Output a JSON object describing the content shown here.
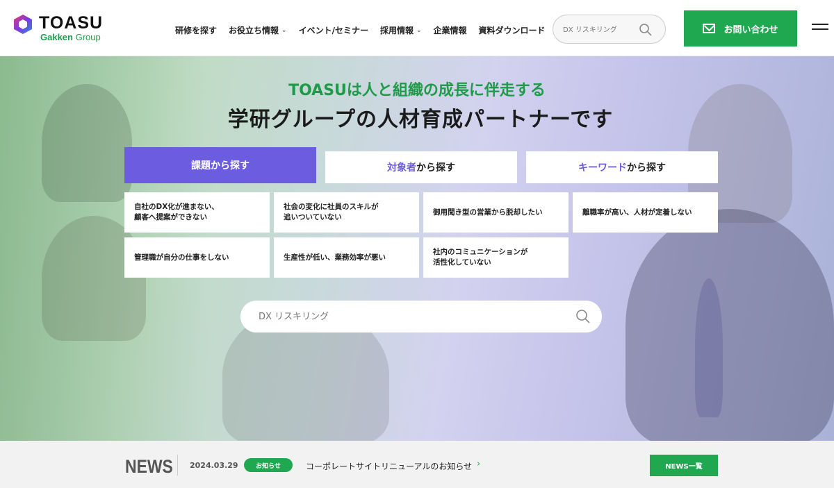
{
  "brand": {
    "name": "TOASU",
    "sub_bold": "Gakken",
    "sub_light": " Group"
  },
  "nav": [
    {
      "label": "研修を探す",
      "dropdown": false
    },
    {
      "label": "お役立ち情報",
      "dropdown": true
    },
    {
      "label": "イベント/セミナー",
      "dropdown": false
    },
    {
      "label": "採用情報",
      "dropdown": true
    },
    {
      "label": "企業情報",
      "dropdown": false
    },
    {
      "label": "資料ダウンロード",
      "dropdown": false
    }
  ],
  "header_search": {
    "placeholder": "DX リスキリング"
  },
  "contact_button": {
    "label": "お問い合わせ"
  },
  "hero": {
    "subtitle": "TOASUは人と組織の成長に伴走する",
    "title": "学研グループの人材育成パートナーです",
    "tabs": {
      "issue": {
        "label": "課題から探す"
      },
      "target": {
        "highlight": "対象者",
        "rest": "から探す"
      },
      "keyword": {
        "highlight": "キーワード",
        "rest": "から探す"
      }
    },
    "cards": [
      {
        "line1": "自社のDX化が進まない、",
        "line2": "顧客へ提案ができない"
      },
      {
        "line1": "社会の変化に社員のスキルが",
        "line2": "追いついていない"
      },
      {
        "line1": "御用聞き型の営業から脱却したい",
        "line2": ""
      },
      {
        "line1": "離職率が高い、人材が定着しない",
        "line2": ""
      },
      {
        "line1": "管理職が自分の仕事をしない",
        "line2": ""
      },
      {
        "line1": "生産性が低い、業務効率が悪い",
        "line2": ""
      },
      {
        "line1": "社内のコミュニケーションが",
        "line2": "活性化していない"
      }
    ],
    "search": {
      "placeholder": "DX リスキリング"
    }
  },
  "news": {
    "label": "NEWS",
    "date": "2024.03.29",
    "badge": "お知らせ",
    "title": "コーポレートサイトリニューアルのお知らせ",
    "chevron": "›",
    "all_button": "NEWS一覧"
  },
  "colors": {
    "green": "#1fa84f",
    "purple": "#6b5ce0"
  }
}
